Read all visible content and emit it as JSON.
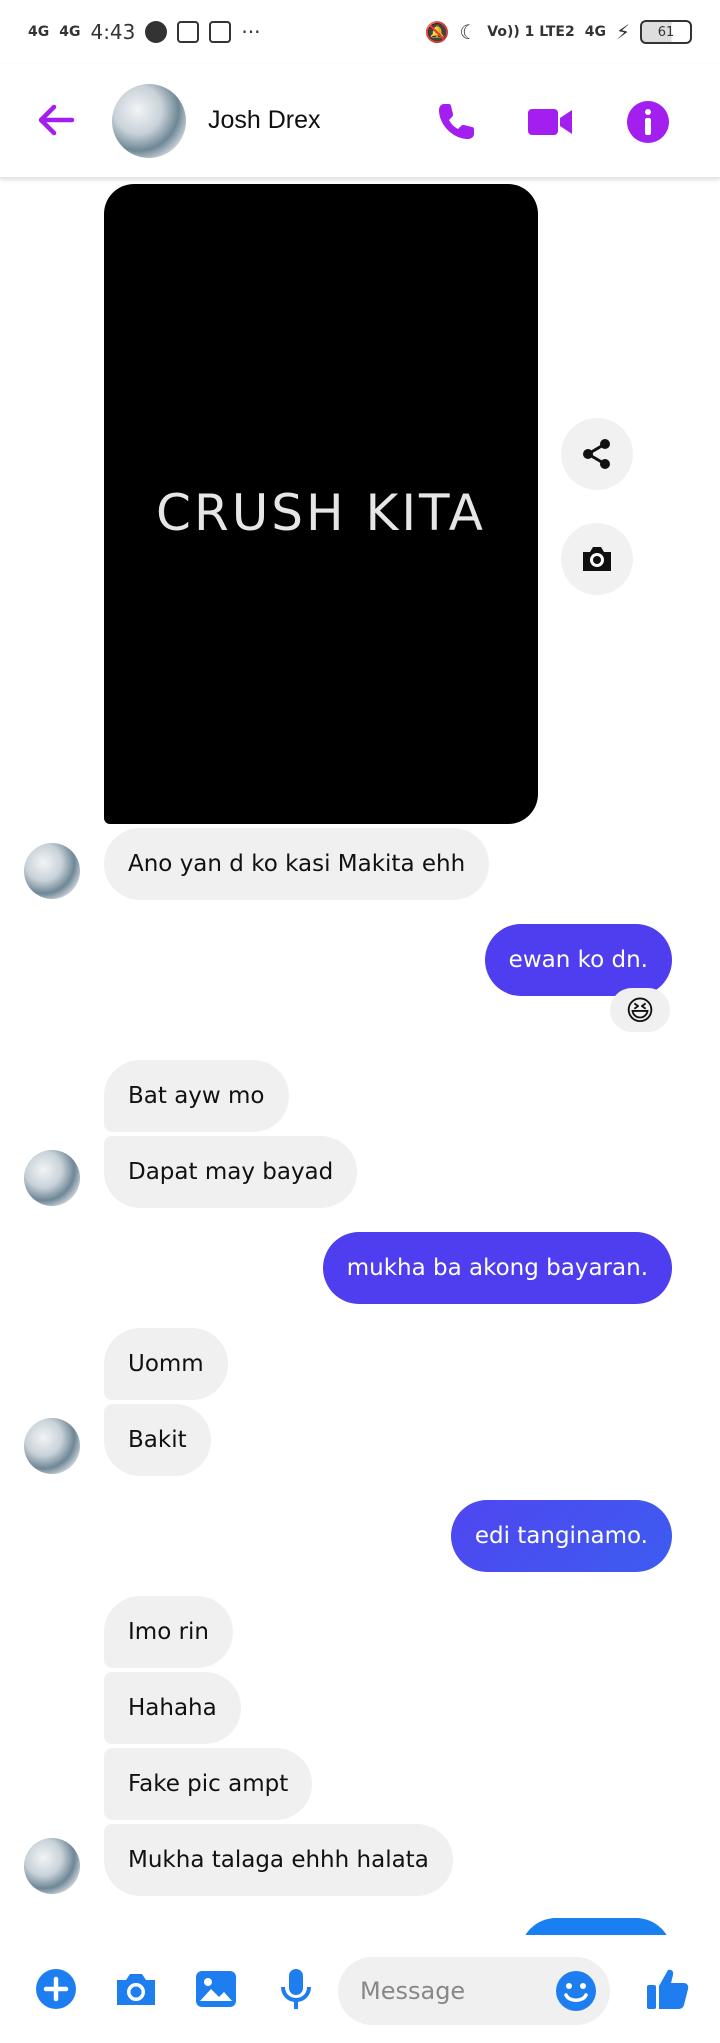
{
  "status_bar": {
    "signal_1": "4G",
    "signal_2": "4G",
    "time": "4:43",
    "network_label": "Vo)) 1 LTE2",
    "network_4g": "4G",
    "battery": "61"
  },
  "header": {
    "contact_name": "Josh Drex"
  },
  "media": {
    "text": "CRUSH KITA"
  },
  "messages": [
    {
      "text": "Ano yan d ko kasi Makita ehh"
    },
    {
      "text": "ewan ko dn."
    },
    {
      "text": "Bat ayw mo"
    },
    {
      "text": "Dapat may bayad"
    },
    {
      "text": "mukha ba akong bayaran."
    },
    {
      "text": "Uomm"
    },
    {
      "text": "Bakit"
    },
    {
      "text": "edi tanginamo."
    },
    {
      "text": "Imo rin"
    },
    {
      "text": "Hahaha"
    },
    {
      "text": "Fake pic ampt"
    },
    {
      "text": "Mukha talaga ehhh halata"
    }
  ],
  "reaction": {
    "emoji": "😆"
  },
  "composer": {
    "placeholder": "Message"
  },
  "colors": {
    "accent": "#a21ff0",
    "outgoing_bubble": "#4f3df0",
    "incoming_bubble": "#f0f0f0",
    "composer_icon": "#1e7ef0"
  },
  "icons": {
    "back": "arrow-left-icon",
    "call": "phone-icon",
    "video": "video-camera-icon",
    "info": "info-icon",
    "share": "share-icon",
    "camera": "camera-icon",
    "plus": "plus-icon",
    "gallery": "image-icon",
    "mic": "microphone-icon",
    "emoji": "smiley-icon",
    "like": "thumbs-up-icon"
  }
}
